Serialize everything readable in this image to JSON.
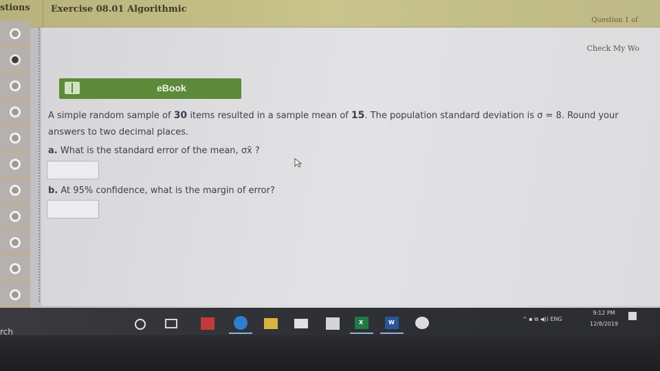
{
  "header": {
    "questions_label": "stions",
    "exercise_title": "Exercise 08.01 Algorithmic",
    "question_number": "Question 1 of"
  },
  "sidebar": {
    "items": [
      {
        "status": "unanswered"
      },
      {
        "status": "answered"
      },
      {
        "status": "unanswered"
      },
      {
        "status": "unanswered"
      },
      {
        "status": "unanswered"
      },
      {
        "status": "unanswered"
      },
      {
        "status": "unanswered"
      },
      {
        "status": "unanswered"
      },
      {
        "status": "unanswered"
      },
      {
        "status": "unanswered"
      },
      {
        "status": "unanswered"
      }
    ]
  },
  "main": {
    "check_my_work": "Check My Wo",
    "ebook_label": "eBook",
    "question": {
      "part1": "A simple random sample of",
      "n": "30",
      "part2": "items resulted in a sample mean of",
      "mean": "15",
      "part3": ". The population standard deviation is σ = 8. Round your",
      "line2": "answers to two decimal places."
    },
    "part_a": {
      "letter": "a.",
      "text": "What is the standard error of the mean,",
      "symbol": "σx̄ ?",
      "answer": ""
    },
    "part_b": {
      "letter": "b.",
      "text_pre": "At",
      "confidence": "95%",
      "text_post": "confidence, what is the margin of error?",
      "answer": ""
    }
  },
  "taskbar": {
    "search_remnant": "rch",
    "excel_label": "X",
    "word_label": "W",
    "tray_lang": "ENG",
    "time": "9:12 PM",
    "date": "12/8/2019"
  },
  "colors": {
    "ebook_green": "#5d8a3a",
    "header_olive": "#c9c48c",
    "text_dark": "#3b3f4d"
  }
}
